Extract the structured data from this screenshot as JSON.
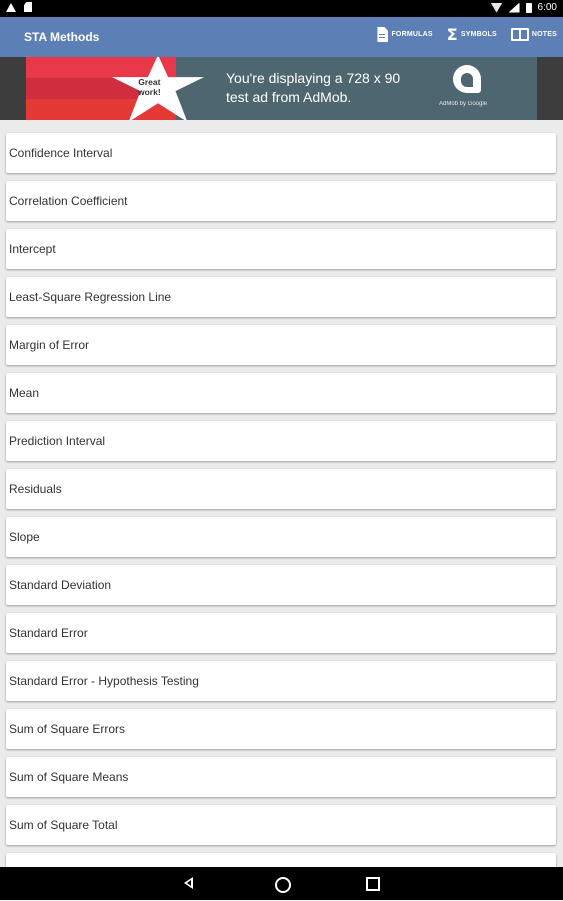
{
  "status_bar": {
    "time": "6:00",
    "icons": [
      "warning-icon",
      "sd-card-icon",
      "wifi-icon",
      "signal-icon",
      "battery-icon"
    ]
  },
  "toolbar": {
    "title": "STA Methods",
    "actions": [
      {
        "label": "FORMULAS",
        "icon": "file-icon"
      },
      {
        "label": "SYMBOLS",
        "icon": "sigma-icon"
      },
      {
        "label": "NOTES",
        "icon": "book-icon"
      }
    ],
    "color": "#5c7fb6"
  },
  "ad": {
    "badge_line1": "Great",
    "badge_line2": "work!",
    "text_line1": "You're displaying a 728 x 90",
    "text_line2": "test ad from AdMob.",
    "caption": "AdMob by Google"
  },
  "list": {
    "items": [
      "Confidence Interval",
      "Correlation Coefficient",
      "Intercept",
      "Least-Square Regression Line",
      "Margin of Error",
      "Mean",
      "Prediction Interval",
      "Residuals",
      "Slope",
      "Standard Deviation",
      "Standard Error",
      "Standard Error - Hypothesis Testing",
      "Sum of Square Errors",
      "Sum of Square Means",
      "Sum of Square Total",
      ""
    ]
  },
  "nav_bar": {
    "buttons": [
      "back-icon",
      "home-icon",
      "recent-apps-icon"
    ]
  }
}
